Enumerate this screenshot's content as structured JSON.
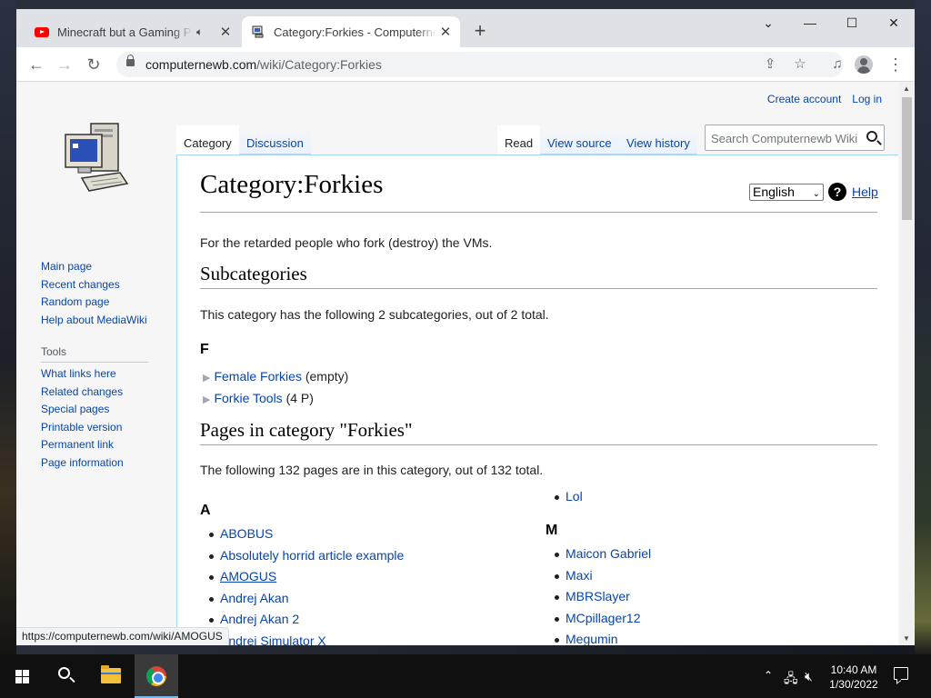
{
  "browser": {
    "tabs": [
      {
        "title": "Minecraft but a Gaming PC - YouTube",
        "favicon": "youtube-icon",
        "audio_icon": "speaker-icon",
        "close": "✕"
      },
      {
        "title": "Category:Forkies - Computernewb Wiki",
        "favicon": "computer-icon",
        "close": "✕"
      }
    ],
    "new_tab_icon": "+",
    "url_host": "computernewb.com",
    "url_path": "/wiki/Category:Forkies",
    "status_url": "https://computernewb.com/wiki/AMOGUS"
  },
  "wiki": {
    "personal": {
      "create_account": "Create account",
      "log_in": "Log in"
    },
    "nav": [
      "Main page",
      "Recent changes",
      "Random page",
      "Help about MediaWiki"
    ],
    "tools_heading": "Tools",
    "tools": [
      "What links here",
      "Related changes",
      "Special pages",
      "Printable version",
      "Permanent link",
      "Page information"
    ],
    "tabs_left": [
      "Category",
      "Discussion"
    ],
    "tabs_right": [
      "Read",
      "View source",
      "View history"
    ],
    "search_placeholder": "Search Computernewb Wiki",
    "title": "Category:Forkies",
    "language": "English",
    "help_icon": "?",
    "help": "Help",
    "description": "For the retarded people who fork (destroy) the VMs.",
    "subcategories_heading": "Subcategories",
    "subcategories_summary": "This category has the following 2 subcategories, out of 2 total.",
    "subcategory_letter": "F",
    "subcategories": [
      {
        "name": "Female Forkies",
        "meta": "(empty)"
      },
      {
        "name": "Forkie Tools",
        "meta": "(4 P)"
      }
    ],
    "pages_heading": "Pages in category \"Forkies\"",
    "pages_summary": "The following 132 pages are in this category, out of 132 total.",
    "col1_letter": "A",
    "col1_pages": [
      "ABOBUS",
      "Absolutely horrid article example",
      "AMOGUS",
      "Andrej Akan",
      "Andrej Akan 2",
      "Andrej Simulator X"
    ],
    "col2_top_pages": [
      "Lol"
    ],
    "col2_letter": "M",
    "col2_pages": [
      "Maicon Gabriel",
      "Maxi",
      "MBRSlayer",
      "MCpillager12",
      "Megumin"
    ]
  },
  "taskbar": {
    "time": "10:40 AM",
    "date": "1/30/2022",
    "apps": [
      "start-button",
      "search-icon",
      "file-explorer-icon",
      "chrome-icon"
    ]
  },
  "colors": {
    "link": "#0645ad",
    "tab_strip": "#dee1e6",
    "taskbar": "#101010"
  }
}
